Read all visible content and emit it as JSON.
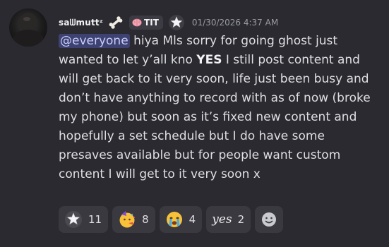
{
  "message": {
    "author": {
      "username": "saᗯmuttᶻ",
      "role_tag": "TIT"
    },
    "timestamp": "01/30/2026 4:37 AM",
    "mention": "@everyone",
    "lines": [
      " hiya Mls sorry for going ghost just",
      "wanted to let y’all kno ",
      " I still post content and",
      "will get back to it very soon, life just been busy and",
      "don’t have anything to record with as of now (broke",
      "my phone) but soon as it’s fixed new content and",
      "hopefully a set schedule but I do have some",
      "presaves available but for people want custom",
      "content I will get to it very soon x"
    ],
    "emphasis": "YES"
  },
  "reactions": [
    {
      "emoji": "star-eyes-icon",
      "count": "11"
    },
    {
      "emoji": "party-face-icon",
      "count": "8"
    },
    {
      "emoji": "crying-face-icon",
      "count": "4"
    },
    {
      "emoji": "yes-sticker",
      "label": "yes",
      "count": "2"
    }
  ],
  "colors": {
    "background": "#2b2a30",
    "mention_bg": "#3d4270",
    "mention_text": "#c9cdfb",
    "reaction_bg": "#3a3940",
    "timestamp": "#9a9ba3"
  }
}
